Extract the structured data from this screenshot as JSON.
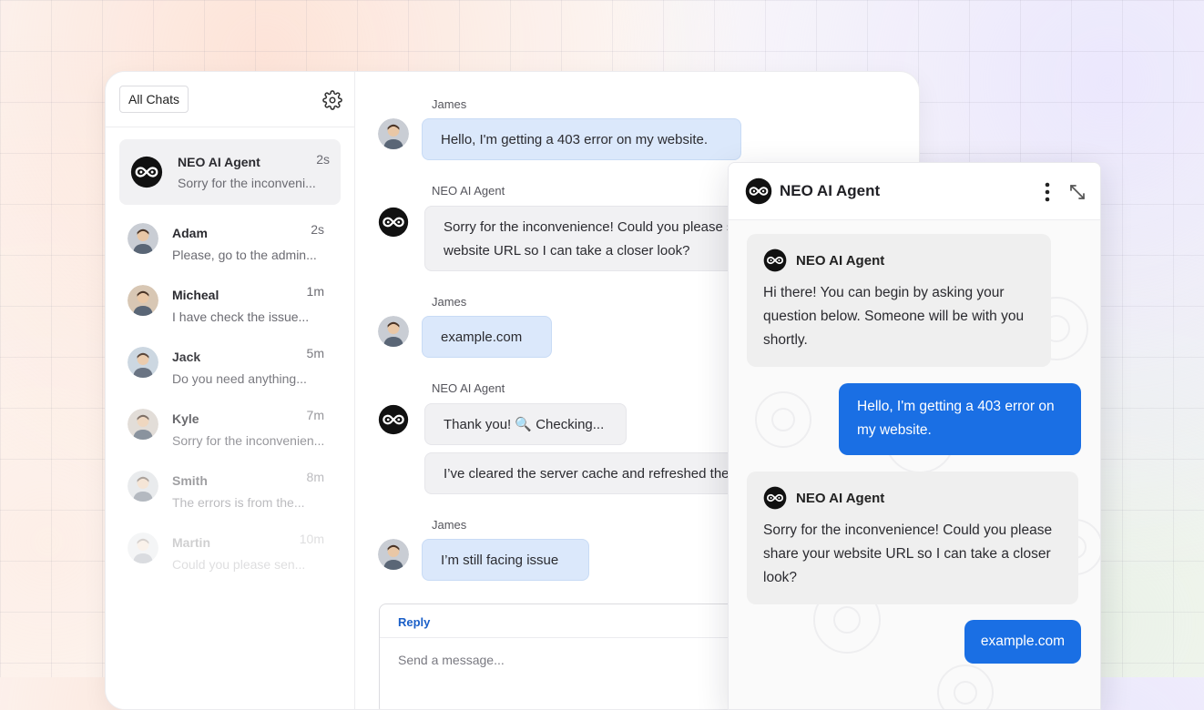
{
  "sidebar": {
    "filter_label": "All Chats",
    "chats": [
      {
        "name": "NEO AI Agent",
        "preview": "Sorry for the inconveni...",
        "time": "2s"
      },
      {
        "name": "Adam",
        "preview": "Please, go to the admin...",
        "time": "2s"
      },
      {
        "name": "Micheal",
        "preview": "I have check the issue...",
        "time": "1m"
      },
      {
        "name": "Jack",
        "preview": "Do you need anything...",
        "time": "5m"
      },
      {
        "name": "Kyle",
        "preview": "Sorry for the inconvenien...",
        "time": "7m"
      },
      {
        "name": "Smith",
        "preview": "The errors is from the...",
        "time": "8m"
      },
      {
        "name": "Martin",
        "preview": "Could you please sen...",
        "time": "10m"
      }
    ]
  },
  "conversation": {
    "messages": [
      {
        "sender": "James",
        "text": "Hello, I'm getting a 403 error on my website."
      },
      {
        "sender": "NEO AI Agent",
        "line1": "Sorry for the inconvenience! Could you please share your",
        "line2": "website URL so I can take a closer look?"
      },
      {
        "sender": "James",
        "text": "example.com"
      },
      {
        "sender": "NEO AI Agent",
        "text": "Thank you! 🔍 Checking...",
        "text2": "I’ve cleared the server cache and refreshed the page."
      },
      {
        "sender": "James",
        "text": "I’m still facing issue"
      }
    ],
    "reply_tab": "Reply",
    "input_placeholder": "Send a message..."
  },
  "widget": {
    "title": "NEO AI Agent",
    "messages": [
      {
        "from": "agent",
        "name": "NEO AI Agent",
        "text": "Hi there! You can begin by asking your question below. Someone will be with you shortly."
      },
      {
        "from": "user",
        "text": "Hello, I'm getting a 403 error on my website."
      },
      {
        "from": "agent",
        "name": "NEO AI Agent",
        "text": "Sorry for the inconvenience! Could you please share your website URL so I can take a closer look?"
      },
      {
        "from": "user",
        "text": "example.com"
      }
    ]
  },
  "colors": {
    "user_bubble": "#dbe8fb",
    "agent_bubble": "#f1f1f3",
    "widget_user_bubble": "#1a6fe4",
    "reply_tab": "#1a5fc8"
  },
  "icons": {
    "settings": "gear-icon",
    "menu": "vertical-dots-icon",
    "expand": "expand-arrows-icon",
    "agent_logo": "infinity-logo-icon"
  }
}
